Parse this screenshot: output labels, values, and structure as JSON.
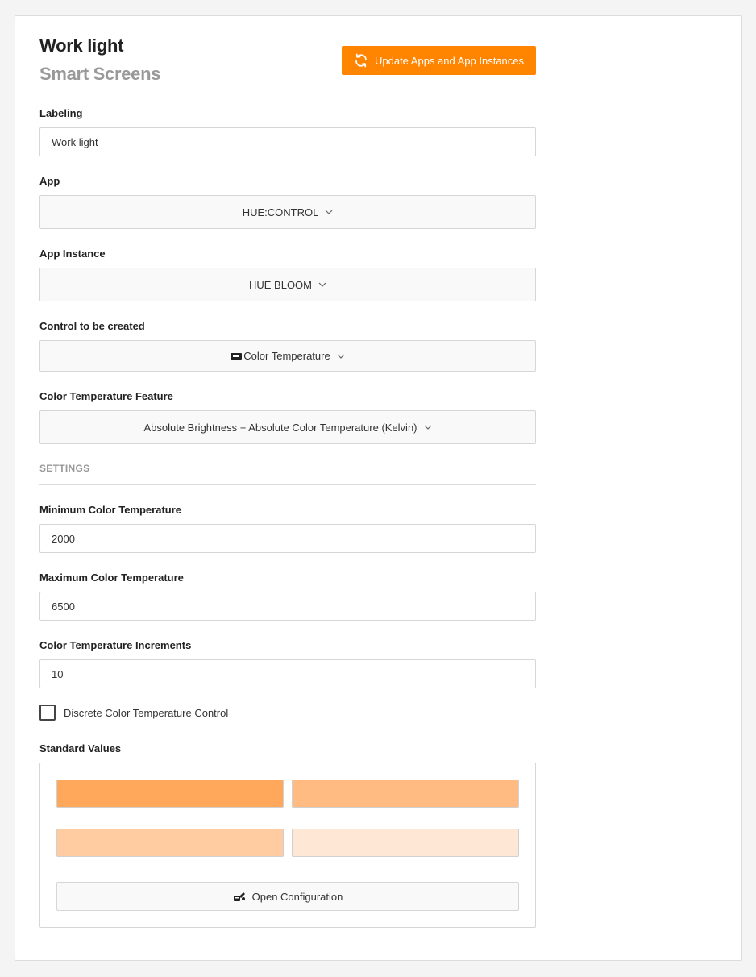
{
  "header": {
    "title": "Work light",
    "subtitle": "Smart Screens",
    "update_button_label": "Update Apps and App Instances",
    "update_button_icon": "refresh-icon",
    "accent_color": "#ff8400"
  },
  "fields": {
    "labeling": {
      "label": "Labeling",
      "value": "Work light"
    },
    "app": {
      "label": "App",
      "value": "HUE:CONTROL"
    },
    "app_instance": {
      "label": "App Instance",
      "value": "HUE BLOOM"
    },
    "control": {
      "label": "Control to be created",
      "value": "Color Temperature",
      "icon": "color-temperature-icon"
    },
    "feature": {
      "label": "Color Temperature Feature",
      "value": "Absolute Brightness + Absolute Color Temperature (Kelvin)"
    }
  },
  "settings": {
    "heading": "SETTINGS",
    "min_temp": {
      "label": "Minimum Color Temperature",
      "value": "2000"
    },
    "max_temp": {
      "label": "Maximum Color Temperature",
      "value": "6500"
    },
    "increments": {
      "label": "Color Temperature Increments",
      "value": "10"
    },
    "discrete": {
      "label": "Discrete Color Temperature Control",
      "checked": false
    }
  },
  "standard_values": {
    "label": "Standard Values",
    "swatches": [
      "#ffa75a",
      "#ffbb82",
      "#ffcba0",
      "#fee7d5"
    ],
    "open_config_label": "Open Configuration",
    "open_config_icon": "configuration-icon"
  }
}
